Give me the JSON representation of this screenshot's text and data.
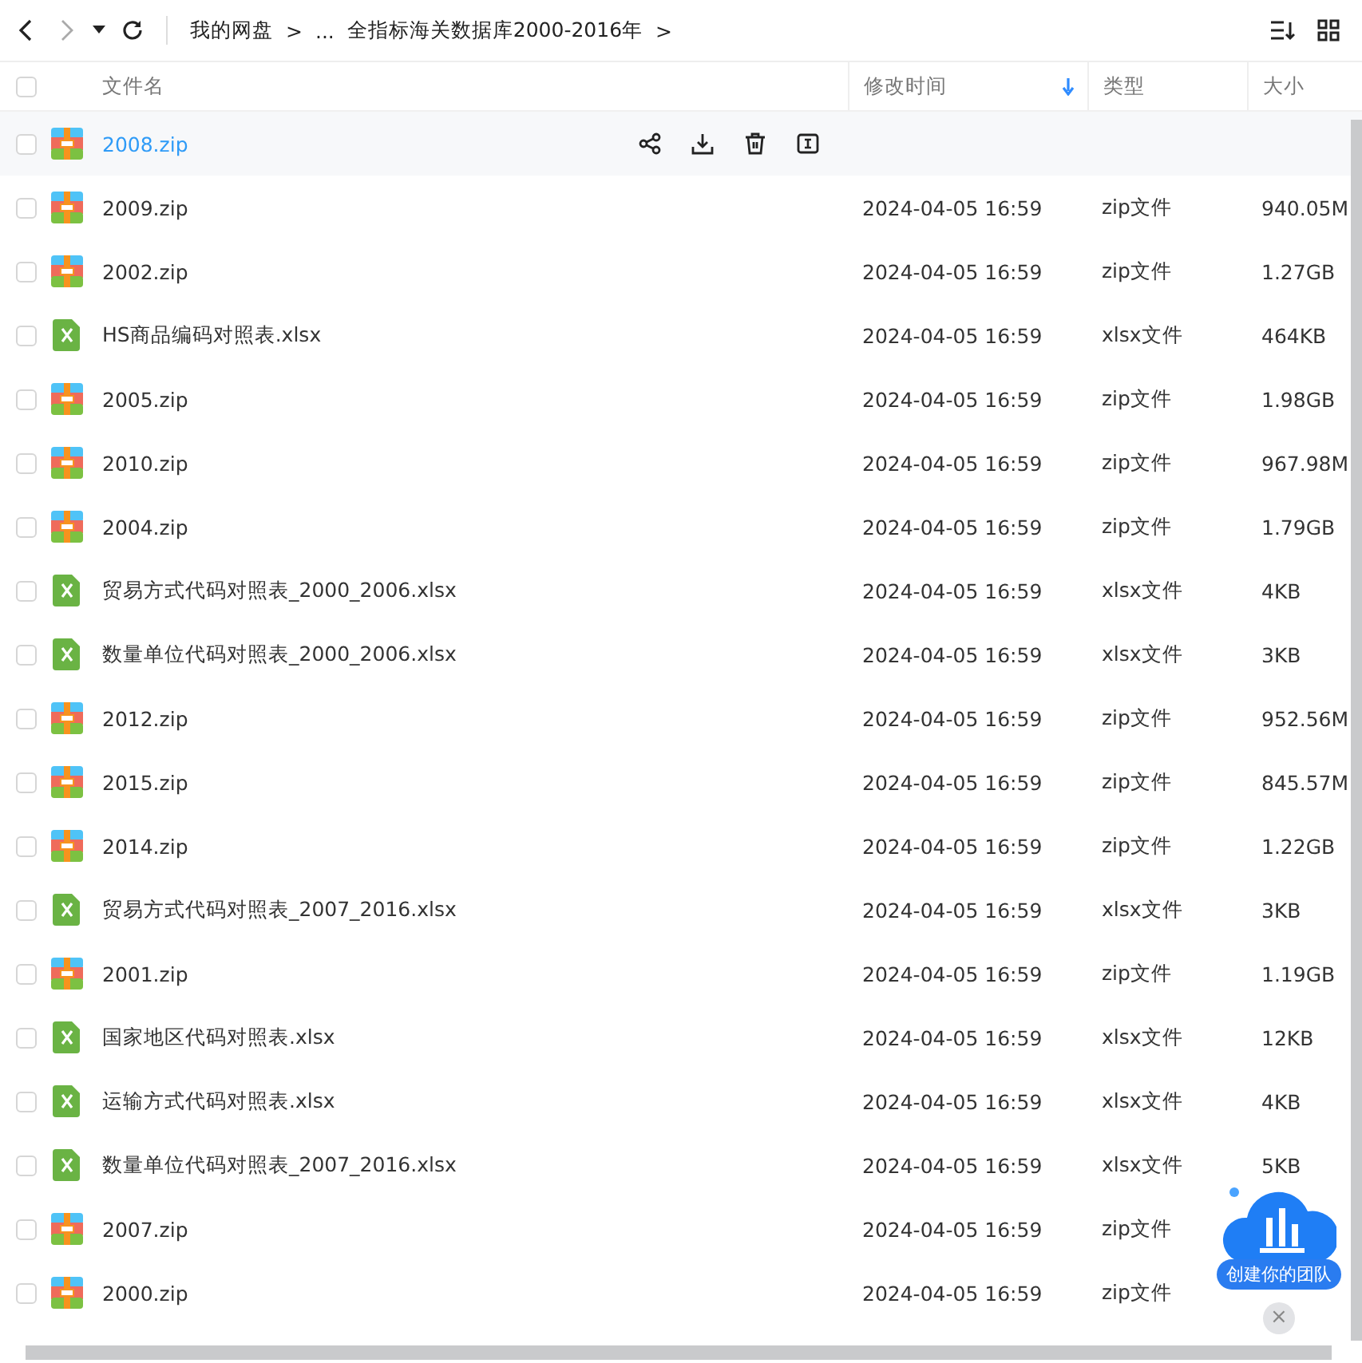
{
  "toolbar": {
    "breadcrumbs": [
      "我的网盘",
      ">",
      "...",
      "全指标海关数据库2000-2016年",
      ">"
    ]
  },
  "table": {
    "select_all": {
      "checked": false
    },
    "columns": [
      {
        "label": "文件名"
      },
      {
        "label": "修改时间",
        "sorted": true
      },
      {
        "label": "类型"
      },
      {
        "label": "大小"
      }
    ],
    "rows": [
      {
        "kind": "zip",
        "name": "2008.zip",
        "hovered": true,
        "checked": false
      },
      {
        "kind": "zip",
        "name": "2009.zip",
        "modified": "2024-04-05 16:59",
        "type": "zip文件",
        "size": "940.05M",
        "hovered": false,
        "checked": false
      },
      {
        "kind": "zip",
        "name": "2002.zip",
        "modified": "2024-04-05 16:59",
        "type": "zip文件",
        "size": "1.27GB",
        "hovered": false,
        "checked": false
      },
      {
        "kind": "xlsx",
        "name": "HS商品编码对照表.xlsx",
        "modified": "2024-04-05 16:59",
        "type": "xlsx文件",
        "size": "464KB",
        "hovered": false,
        "checked": false
      },
      {
        "kind": "zip",
        "name": "2005.zip",
        "modified": "2024-04-05 16:59",
        "type": "zip文件",
        "size": "1.98GB",
        "hovered": false,
        "checked": false
      },
      {
        "kind": "zip",
        "name": "2010.zip",
        "modified": "2024-04-05 16:59",
        "type": "zip文件",
        "size": "967.98M",
        "hovered": false,
        "checked": false
      },
      {
        "kind": "zip",
        "name": "2004.zip",
        "modified": "2024-04-05 16:59",
        "type": "zip文件",
        "size": "1.79GB",
        "hovered": false,
        "checked": false
      },
      {
        "kind": "xlsx",
        "name": "贸易方式代码对照表_2000_2006.xlsx",
        "modified": "2024-04-05 16:59",
        "type": "xlsx文件",
        "size": "4KB",
        "hovered": false,
        "checked": false
      },
      {
        "kind": "xlsx",
        "name": "数量单位代码对照表_2000_2006.xlsx",
        "modified": "2024-04-05 16:59",
        "type": "xlsx文件",
        "size": "3KB",
        "hovered": false,
        "checked": false
      },
      {
        "kind": "zip",
        "name": "2012.zip",
        "modified": "2024-04-05 16:59",
        "type": "zip文件",
        "size": "952.56M",
        "hovered": false,
        "checked": false
      },
      {
        "kind": "zip",
        "name": "2015.zip",
        "modified": "2024-04-05 16:59",
        "type": "zip文件",
        "size": "845.57M",
        "hovered": false,
        "checked": false
      },
      {
        "kind": "zip",
        "name": "2014.zip",
        "modified": "2024-04-05 16:59",
        "type": "zip文件",
        "size": "1.22GB",
        "hovered": false,
        "checked": false
      },
      {
        "kind": "xlsx",
        "name": "贸易方式代码对照表_2007_2016.xlsx",
        "modified": "2024-04-05 16:59",
        "type": "xlsx文件",
        "size": "3KB",
        "hovered": false,
        "checked": false
      },
      {
        "kind": "zip",
        "name": "2001.zip",
        "modified": "2024-04-05 16:59",
        "type": "zip文件",
        "size": "1.19GB",
        "hovered": false,
        "checked": false
      },
      {
        "kind": "xlsx",
        "name": "国家地区代码对照表.xlsx",
        "modified": "2024-04-05 16:59",
        "type": "xlsx文件",
        "size": "12KB",
        "hovered": false,
        "checked": false
      },
      {
        "kind": "xlsx",
        "name": "运输方式代码对照表.xlsx",
        "modified": "2024-04-05 16:59",
        "type": "xlsx文件",
        "size": "4KB",
        "hovered": false,
        "checked": false
      },
      {
        "kind": "xlsx",
        "name": "数量单位代码对照表_2007_2016.xlsx",
        "modified": "2024-04-05 16:59",
        "type": "xlsx文件",
        "size": "5KB",
        "hovered": false,
        "checked": false
      },
      {
        "kind": "zip",
        "name": "2007.zip",
        "modified": "2024-04-05 16:59",
        "type": "zip文件",
        "hovered": false,
        "checked": false
      },
      {
        "kind": "zip",
        "name": "2000.zip",
        "modified": "2024-04-05 16:59",
        "type": "zip文件",
        "hovered": false,
        "checked": false
      }
    ]
  },
  "promo": {
    "label": "创建你的团队",
    "close": "×"
  }
}
